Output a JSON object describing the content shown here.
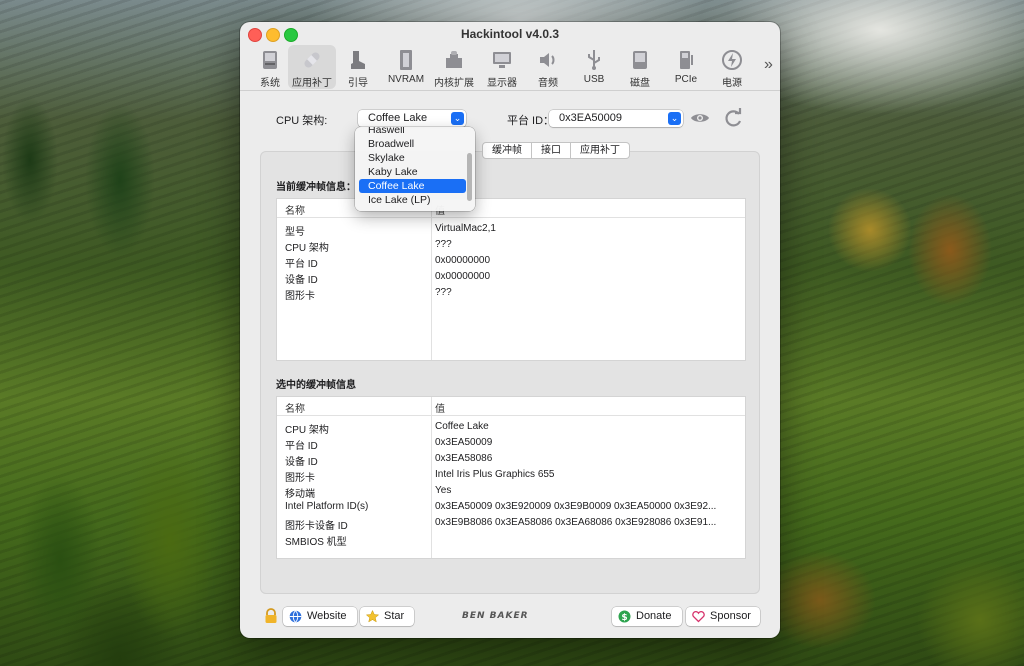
{
  "window": {
    "title": "Hackintool v4.0.3"
  },
  "toolbar": {
    "items": [
      {
        "label": "系统",
        "icon": "system-icon"
      },
      {
        "label": "应用补丁",
        "icon": "patch-icon"
      },
      {
        "label": "引导",
        "icon": "boot-icon"
      },
      {
        "label": "NVRAM",
        "icon": "nvram-icon"
      },
      {
        "label": "内核扩展",
        "icon": "kext-icon"
      },
      {
        "label": "显示器",
        "icon": "display-icon"
      },
      {
        "label": "音频",
        "icon": "audio-icon"
      },
      {
        "label": "USB",
        "icon": "usb-icon"
      },
      {
        "label": "磁盘",
        "icon": "disk-icon"
      },
      {
        "label": "PCIe",
        "icon": "pcie-icon"
      },
      {
        "label": "电源",
        "icon": "power-icon"
      }
    ],
    "more": "»"
  },
  "controls": {
    "cpu_label": "CPU 架构:",
    "cpu_value": "Coffee Lake",
    "platform_label": "平台 ID：",
    "platform_value": "0x3EA50009",
    "chevron": "⌄"
  },
  "dropdown": {
    "items": [
      "Haswell",
      "Broadwell",
      "Skylake",
      "Kaby Lake",
      "Coffee Lake",
      "Ice Lake (LP)"
    ],
    "selected": "Coffee Lake"
  },
  "tabs": [
    "缓冲帧",
    "接口",
    "应用补丁"
  ],
  "current_fb": {
    "title": "当前缓冲帧信息：",
    "headers": [
      "名称",
      "值"
    ],
    "rows": [
      [
        "型号",
        "VirtualMac2,1"
      ],
      [
        "CPU 架构",
        "???"
      ],
      [
        "平台 ID",
        "0x00000000"
      ],
      [
        "设备 ID",
        "0x00000000"
      ],
      [
        "图形卡",
        "???"
      ]
    ]
  },
  "selected_fb": {
    "title": "选中的缓冲帧信息",
    "headers": [
      "名称",
      "值"
    ],
    "rows": [
      [
        "CPU 架构",
        "Coffee Lake"
      ],
      [
        "平台 ID",
        "0x3EA50009"
      ],
      [
        "设备 ID",
        "0x3EA58086"
      ],
      [
        "图形卡",
        "Intel Iris Plus Graphics 655"
      ],
      [
        "移动端",
        "Yes"
      ],
      [
        "Intel Platform ID(s)",
        "0x3EA50009 0x3E920009 0x3E9B0009 0x3EA50000 0x3E92..."
      ],
      [
        "图形卡设备 ID",
        "0x3E9B8086 0x3EA58086 0x3EA68086 0x3E928086 0x3E91..."
      ],
      [
        "SMBIOS 机型",
        ""
      ]
    ]
  },
  "bottom": {
    "website": "Website",
    "star": "Star",
    "logo": "BEN BAKER",
    "donate": "Donate",
    "sponsor": "Sponsor"
  },
  "colors": {
    "accent": "#1a6ff5",
    "close": "#ff5f57",
    "minimize": "#febc2e",
    "maximize": "#28c840"
  }
}
